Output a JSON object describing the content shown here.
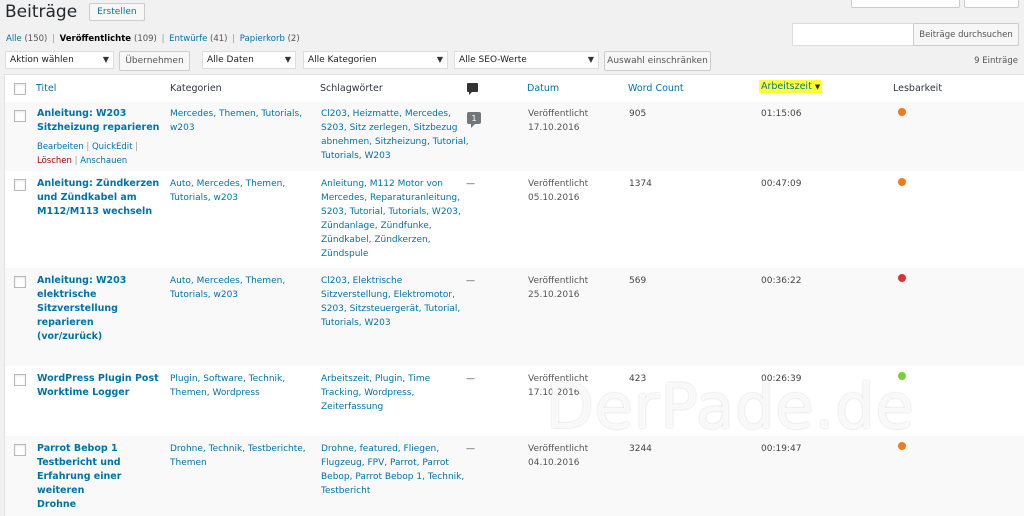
{
  "header": {
    "title": "Beiträge",
    "add_button": "Erstellen"
  },
  "views": [
    {
      "label": "Alle",
      "count": "(150)"
    },
    {
      "label": "Veröffentlichte",
      "count": "(109)"
    },
    {
      "label": "Entwürfe",
      "count": "(41)"
    },
    {
      "label": "Papierkorb",
      "count": "(2)"
    }
  ],
  "search": {
    "value": "",
    "button": "Beiträge durchsuchen"
  },
  "toolbar": {
    "bulk_action": "Aktion wählen",
    "apply": "Übernehmen",
    "dates": "Alle Daten",
    "categories": "Alle Kategorien",
    "seo": "Alle SEO-Werte",
    "filter": "Auswahl einschränken",
    "items": "9 Einträge"
  },
  "columns": {
    "title": "Titel",
    "categories": "Kategorien",
    "tags": "Schlagwörter",
    "date": "Datum",
    "word_count": "Word Count",
    "worktime": "Arbeitszeit",
    "worktime_sort": "▼",
    "readability": "Lesbarkeit"
  },
  "row_actions": {
    "edit": "Bearbeiten",
    "quickedit": "QuickEdit",
    "trash": "Löschen",
    "view": "Anschauen"
  },
  "posts": [
    {
      "title": [
        "Anleitung: W203",
        "Sitzheizung reparieren"
      ],
      "categories": [
        "Mercedes, Themen, Tutorials,",
        "w203"
      ],
      "tags": [
        "Cl203, Heizmatte, Mercedes,",
        "S203, Sitz zerlegen, Sitzbezug",
        "abnehmen, Sitzheizung, Tutorial,",
        "Tutorials, W203"
      ],
      "comments": "1",
      "status": "Veröffentlicht",
      "date": "17.10.2016",
      "word_count": "905",
      "worktime": "01:15:06",
      "readability_color": "#ee7c1b"
    },
    {
      "title": [
        "Anleitung: Zündkerzen",
        "und Zündkabel am",
        "M112/M113 wechseln"
      ],
      "categories": [
        "Auto, Mercedes, Themen,",
        "Tutorials, w203"
      ],
      "tags": [
        "Anleitung, M112 Motor von",
        "Mercedes, Reparaturanleitung,",
        "S203, Tutorial, Tutorials, W203,",
        "Zündanlage, Zündfunke,",
        "Zündkabel, Zündkerzen,",
        "Zündspule"
      ],
      "comments": "—",
      "status": "Veröffentlicht",
      "date": "05.10.2016",
      "word_count": "1374",
      "worktime": "00:47:09",
      "readability_color": "#ee7c1b"
    },
    {
      "title": [
        "Anleitung: W203",
        "elektrische",
        "Sitzverstellung",
        "reparieren (vor/zurück)"
      ],
      "categories": [
        "Auto, Mercedes, Themen,",
        "Tutorials, w203"
      ],
      "tags": [
        "Cl203, Elektrische",
        "Sitzverstellung, Elektromotor,",
        "S203, Sitzsteuergerät, Tutorial,",
        "Tutorials, W203"
      ],
      "comments": "—",
      "status": "Veröffentlicht",
      "date": "25.10.2016",
      "word_count": "569",
      "worktime": "00:36:22",
      "readability_color": "#dc3232"
    },
    {
      "title": [
        "WordPress Plugin Post",
        "Worktime Logger"
      ],
      "categories": [
        "Plugin, Software, Technik,",
        "Themen, Wordpress"
      ],
      "tags": [
        "Arbeitszeit, Plugin, Time",
        "Tracking, Wordpress,",
        "Zeiterfassung"
      ],
      "comments": "—",
      "status": "Veröffentlicht",
      "date": "17.10.2016",
      "word_count": "423",
      "worktime": "00:26:39",
      "readability_color": "#7ad03a"
    },
    {
      "title": [
        "Parrot Bebop 1",
        "Testbericht und",
        "Erfahrung einer weiteren",
        "Drohne"
      ],
      "categories": [
        "Drohne, Technik, Testberichte,",
        "Themen"
      ],
      "tags": [
        "Drohne, featured, Fliegen,",
        "Flugzeug, FPV, Parrot, Parrot",
        "Bebop, Parrot Bebop 1, Technik,",
        "Testbericht"
      ],
      "comments": "—",
      "status": "Veröffentlicht",
      "date": "04.10.2016",
      "word_count": "3244",
      "worktime": "00:19:47",
      "readability_color": "#ee7c1b"
    }
  ],
  "watermark": "DerPade.de",
  "colors": {
    "link": "#0073aa",
    "highlight": "#ffff33"
  }
}
